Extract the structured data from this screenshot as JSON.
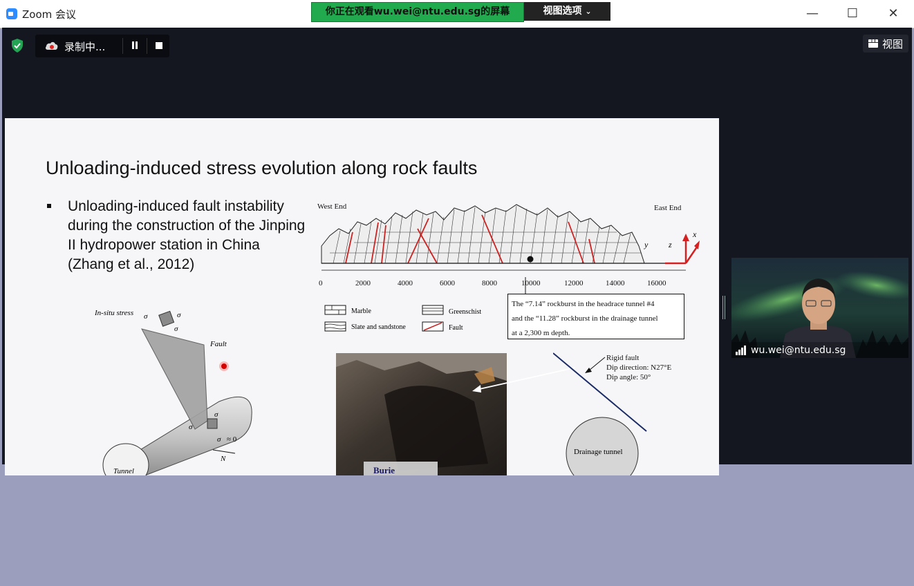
{
  "window": {
    "app_title": "Zoom 会议",
    "share_banner": "你正在观看wu.wei@ntu.edu.sg的屏幕",
    "view_options_label": "视图选项",
    "minimize": "—",
    "maximize": "☐",
    "close": "✕"
  },
  "toolbar": {
    "recording_label": "录制中...",
    "view_label": "视图"
  },
  "slide": {
    "title": "Unloading-induced stress evolution along rock faults",
    "bullet": "Unloading-induced fault instability during the construction of the Jinping II hydropower station in China (Zhang et al., 2012)",
    "profile": {
      "west_end": "West End",
      "east_end": "East End",
      "axis_ticks": [
        "0",
        "2000",
        "4000",
        "6000",
        "8000",
        "10000",
        "12000",
        "14000",
        "16000"
      ],
      "axis_z": "z",
      "axis_x": "x",
      "axis_y": "y"
    },
    "legend": {
      "marble": "Marble",
      "greenschist": "Greenschist",
      "slate": "Slate and sandstone",
      "fault": "Fault"
    },
    "callout": {
      "line1": "The “7.14” rockburst in the headrace tunnel #4",
      "line2": "and the “11.28” rockburst in the drainage tunnel",
      "line3": "at a 2,300 m depth."
    },
    "sketch": {
      "insitu_label": "In-situ stress",
      "fault_label": "Fault",
      "tunnel_label": "Tunnel",
      "n_label": "N",
      "sigma2_0": "σ",
      "approx_zero": "≈ 0"
    },
    "photo_caption": "Burie",
    "fault_info": {
      "line1": "Rigid fault",
      "line2": "Dip direction: N27°E",
      "line3": "Dip angle: 50°",
      "tunnel": "Drainage tunnel"
    }
  },
  "participant": {
    "name": "wu.wei@ntu.edu.sg"
  },
  "colors": {
    "share_banner": "#22aa4f",
    "meeting_bg": "#141720",
    "lower_bg": "#9b9ebd",
    "fault_red": "#cc2222",
    "axis_red": "#d42020"
  }
}
